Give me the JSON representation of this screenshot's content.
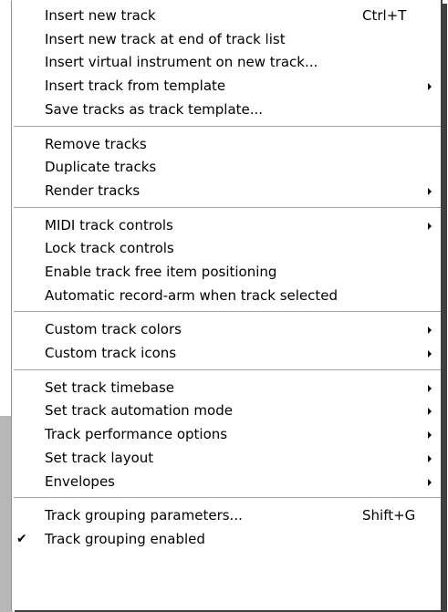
{
  "menu": {
    "groups": [
      {
        "items": [
          {
            "label": "Insert new track",
            "shortcut": "Ctrl+T",
            "submenu": false
          },
          {
            "label": "Insert new track at end of track list",
            "shortcut": "",
            "submenu": false
          },
          {
            "label": "Insert virtual instrument on new track...",
            "shortcut": "",
            "submenu": false
          },
          {
            "label": "Insert track from template",
            "shortcut": "",
            "submenu": true
          },
          {
            "label": "Save tracks as track template...",
            "shortcut": "",
            "submenu": false
          }
        ]
      },
      {
        "items": [
          {
            "label": "Remove tracks",
            "shortcut": "",
            "submenu": false
          },
          {
            "label": "Duplicate tracks",
            "shortcut": "",
            "submenu": false
          },
          {
            "label": "Render tracks",
            "shortcut": "",
            "submenu": true
          }
        ]
      },
      {
        "items": [
          {
            "label": "MIDI track controls",
            "shortcut": "",
            "submenu": true
          },
          {
            "label": "Lock track controls",
            "shortcut": "",
            "submenu": false
          },
          {
            "label": "Enable track free item positioning",
            "shortcut": "",
            "submenu": false
          },
          {
            "label": "Automatic record-arm when track selected",
            "shortcut": "",
            "submenu": false
          }
        ]
      },
      {
        "items": [
          {
            "label": "Custom track colors",
            "shortcut": "",
            "submenu": true
          },
          {
            "label": "Custom track icons",
            "shortcut": "",
            "submenu": true
          }
        ]
      },
      {
        "items": [
          {
            "label": "Set track timebase",
            "shortcut": "",
            "submenu": true
          },
          {
            "label": "Set track automation mode",
            "shortcut": "",
            "submenu": true
          },
          {
            "label": "Track performance options",
            "shortcut": "",
            "submenu": true
          },
          {
            "label": "Set track layout",
            "shortcut": "",
            "submenu": true
          },
          {
            "label": "Envelopes",
            "shortcut": "",
            "submenu": true
          }
        ]
      },
      {
        "items": [
          {
            "label": "Track grouping parameters...",
            "shortcut": "Shift+G",
            "submenu": false
          },
          {
            "label": "Track grouping enabled",
            "shortcut": "",
            "submenu": false,
            "checked": true,
            "check_glyph": "✔"
          }
        ]
      }
    ]
  }
}
